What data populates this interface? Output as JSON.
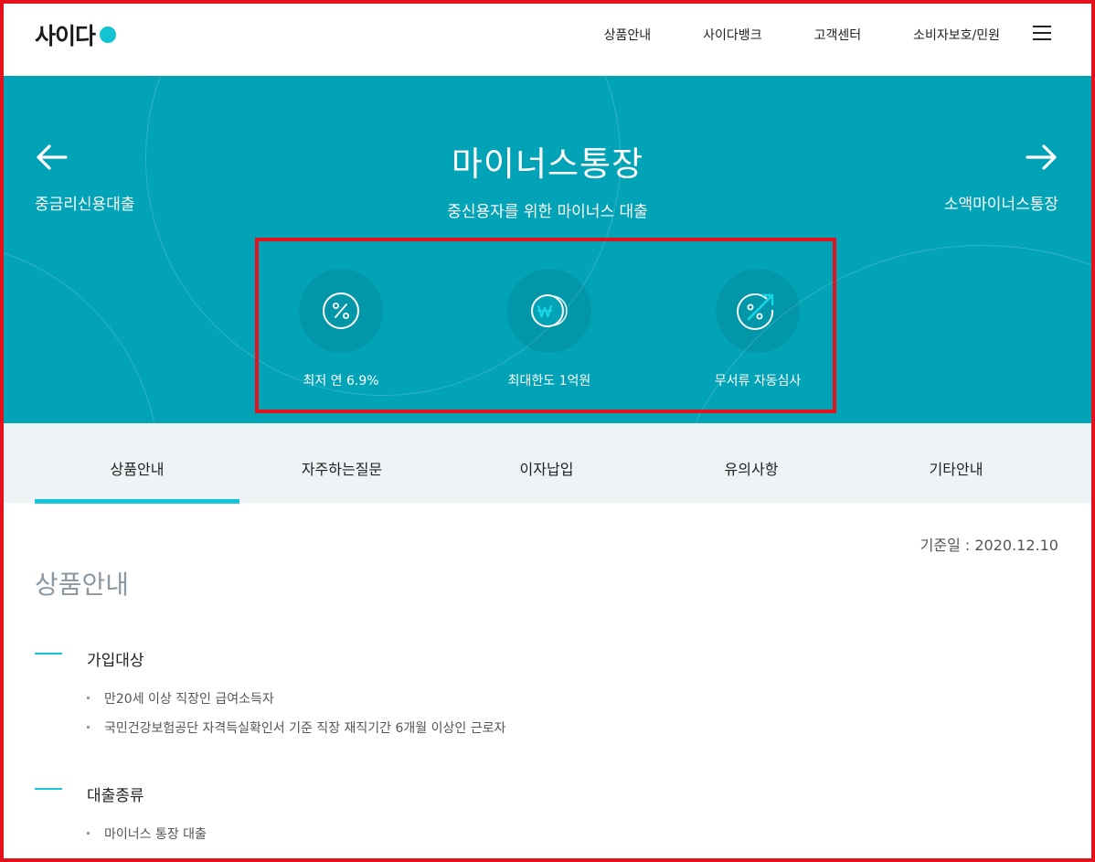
{
  "header": {
    "logo_text": "사이다",
    "nav": [
      "상품안내",
      "사이다뱅크",
      "고객센터",
      "소비자보호/민원"
    ]
  },
  "hero": {
    "prev_label": "중금리신용대출",
    "next_label": "소액마이너스통장",
    "title": "마이너스통장",
    "subtitle": "중신용자를 위한 마이너스 대출",
    "features": [
      {
        "icon": "percent-icon",
        "label": "최저 연 6.9%"
      },
      {
        "icon": "won-coin-icon",
        "label": "최대한도 1억원"
      },
      {
        "icon": "percent-arrow-up-icon",
        "label": "무서류 자동심사"
      }
    ]
  },
  "tabs": [
    {
      "label": "상품안내",
      "active": true
    },
    {
      "label": "자주하는질문",
      "active": false
    },
    {
      "label": "이자납입",
      "active": false
    },
    {
      "label": "유의사항",
      "active": false
    },
    {
      "label": "기타안내",
      "active": false
    }
  ],
  "content": {
    "base_date": "기준일 : 2020.12.10",
    "section_title": "상품안내",
    "groups": [
      {
        "title": "가입대상",
        "items": [
          "만20세 이상 직장인 급여소득자",
          "국민건강보험공단 자격득실확인서 기준 직장 재직기간 6개월 이상인 근로자"
        ]
      },
      {
        "title": "대출종류",
        "items": [
          "마이너스 통장 대출"
        ]
      }
    ]
  },
  "colors": {
    "accent": "#02a3b6",
    "highlight": "#17c6d6",
    "annotation": "#e3121d"
  }
}
